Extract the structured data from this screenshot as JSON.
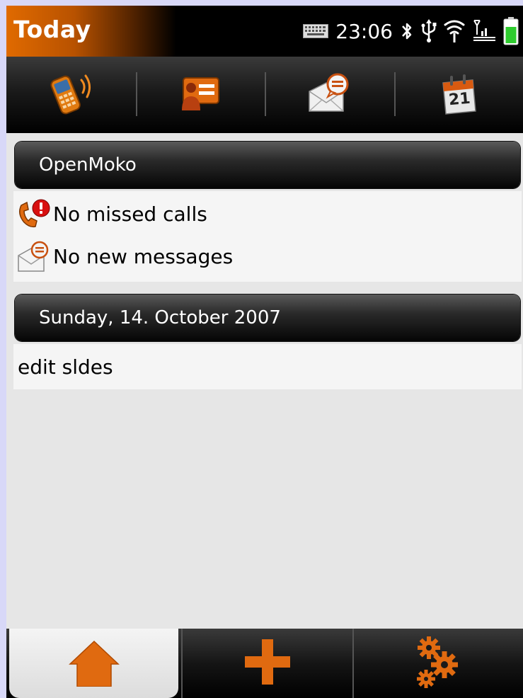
{
  "statusbar": {
    "title": "Today",
    "time": "23:06",
    "icons": [
      "keyboard-icon",
      "bluetooth-icon",
      "usb-icon",
      "wifi-icon",
      "gsm-signal-icon",
      "battery-icon"
    ]
  },
  "toolbar": {
    "items": [
      "phone-icon",
      "contacts-icon",
      "messages-icon",
      "calendar-icon"
    ],
    "calendar_day": "21"
  },
  "sections": {
    "openmoko": {
      "header": "OpenMoko",
      "missed_calls": "No missed calls",
      "new_messages": "No new messages"
    },
    "date": {
      "header": "Sunday, 14. October 2007",
      "task": "edit sldes"
    }
  },
  "bottombar": {
    "tabs": [
      "home-icon",
      "add-icon",
      "settings-icon"
    ],
    "active": "home-icon"
  },
  "colors": {
    "accent": "#e06a00",
    "battery": "#2ecc2e",
    "background": "#e6e6e6"
  }
}
